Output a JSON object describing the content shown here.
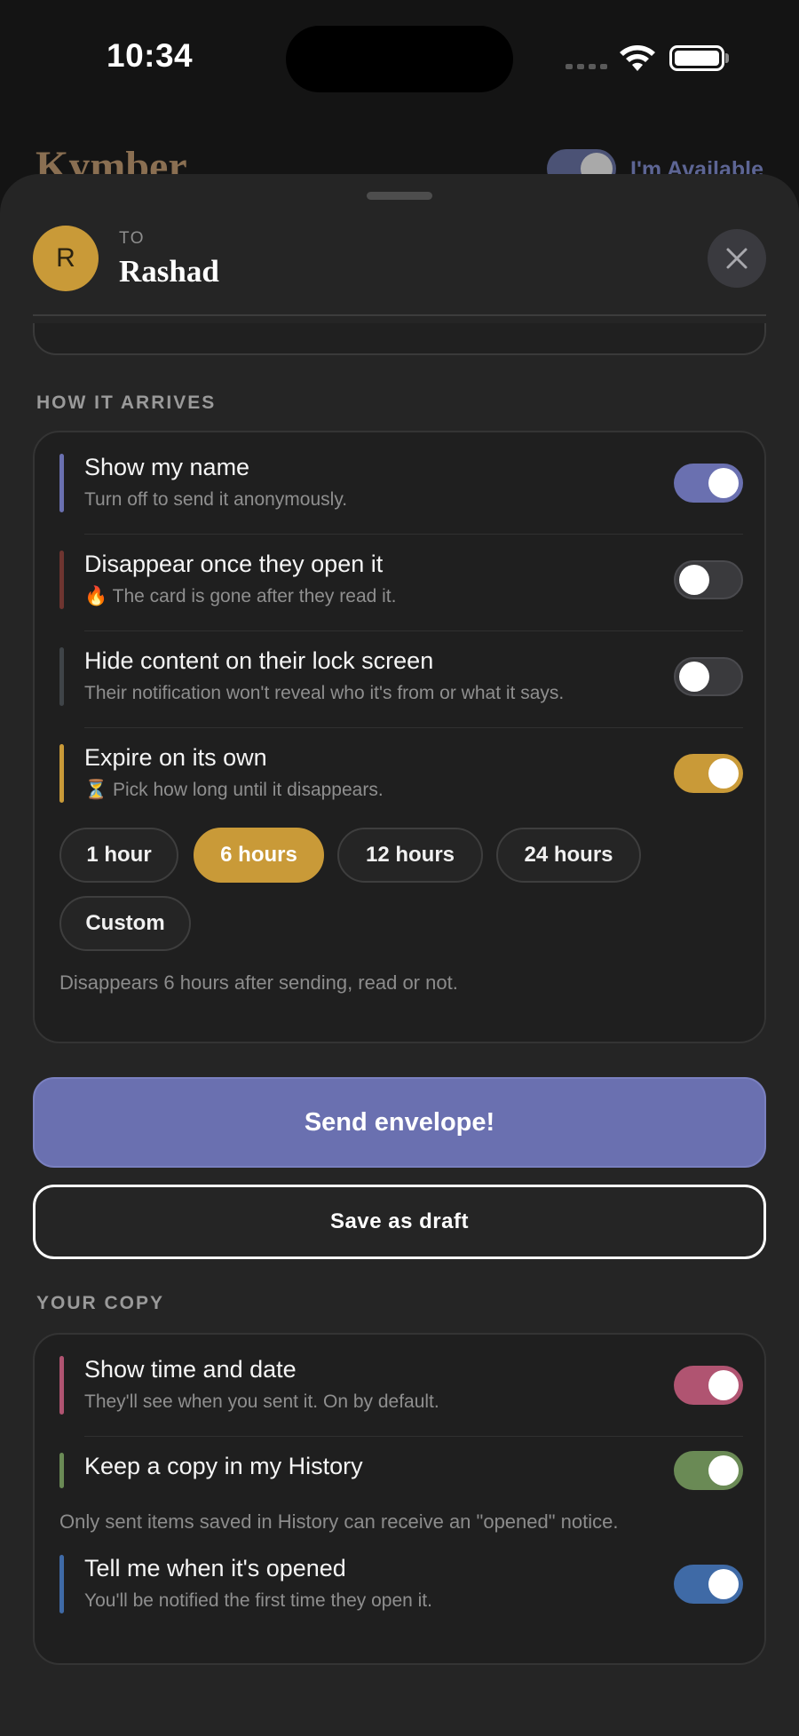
{
  "status_bar": {
    "time": "10:34"
  },
  "background_app": {
    "title": "Kymber",
    "availability_label": "I'm Available"
  },
  "header": {
    "avatar_initial": "R",
    "to_label": "TO",
    "recipient_name": "Rashad"
  },
  "arrival": {
    "section_label": "HOW IT ARRIVES",
    "options": [
      {
        "title": "Show my name",
        "subtitle": "Turn off to send it anonymously.",
        "enabled": true,
        "accent": "#6a70b0"
      },
      {
        "title": "Disappear once they open it",
        "emoji": "🔥",
        "subtitle": "The card is gone after they read it.",
        "enabled": false,
        "accent": "#6e3530"
      },
      {
        "title": "Hide content on their lock screen",
        "subtitle": "Their notification won't reveal who it's from or what it says.",
        "enabled": false,
        "accent": "#3f4448"
      },
      {
        "title": "Expire on its own",
        "emoji": "⏳",
        "subtitle": "Pick how long until it disappears.",
        "enabled": true,
        "accent": "#c99a38"
      }
    ],
    "durations": [
      "1 hour",
      "6 hours",
      "12 hours",
      "24 hours",
      "Custom"
    ],
    "selected_duration": "6 hours",
    "expiry_note": "Disappears 6 hours after sending, read or not."
  },
  "actions": {
    "send_label": "Send envelope!",
    "draft_label": "Save as draft"
  },
  "copy": {
    "section_label": "YOUR COPY",
    "options": [
      {
        "title": "Show time and date",
        "subtitle": "They'll see when you sent it. On by default.",
        "enabled": true,
        "accent": "#b05471"
      },
      {
        "title": "Keep a copy in my History",
        "subtitle": "",
        "enabled": true,
        "accent": "#6a8a55"
      },
      {
        "title": "Tell me when it's opened",
        "subtitle": "You'll be notified the first time they open it.",
        "enabled": true,
        "accent": "#3f6aa6"
      }
    ],
    "history_note": "Only sent items saved in History can receive an \"opened\" notice."
  },
  "colors": {
    "accent_purple": "#6a70b0",
    "accent_gold": "#c99a38",
    "toggle_pink": "#b05471",
    "toggle_green": "#6a8a55",
    "toggle_blue": "#3f6aa6"
  },
  "icons": [
    "wifi-icon",
    "battery-icon",
    "close-icon",
    "fire-emoji",
    "hourglass-emoji"
  ]
}
